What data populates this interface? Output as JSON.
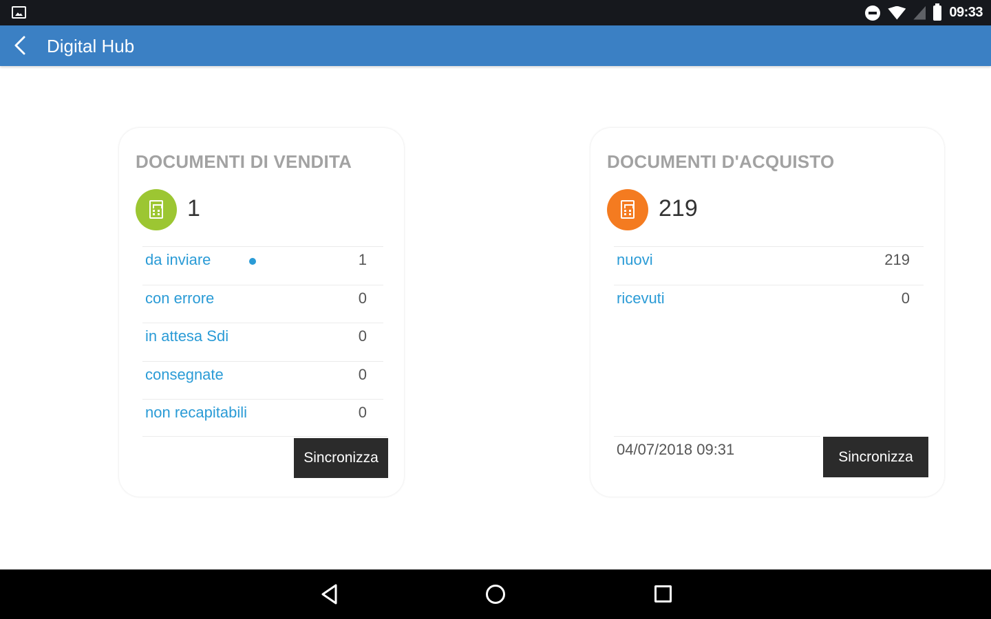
{
  "statusbar": {
    "time": "09:33"
  },
  "appbar": {
    "title": "Digital Hub"
  },
  "sales": {
    "title": "DOCUMENTI DI VENDITA",
    "count": "1",
    "rows": [
      {
        "label": "da inviare",
        "value": "1"
      },
      {
        "label": "con errore",
        "value": "0"
      },
      {
        "label": "in attesa Sdi",
        "value": "0"
      },
      {
        "label": "consegnate",
        "value": "0"
      },
      {
        "label": "non recapitabili",
        "value": "0"
      }
    ],
    "sync_label": "Sincronizza"
  },
  "purchases": {
    "title": "DOCUMENTI D'ACQUISTO",
    "count": "219",
    "rows": [
      {
        "label": "nuovi",
        "value": "219"
      },
      {
        "label": "ricevuti",
        "value": "0"
      }
    ],
    "timestamp": "04/07/2018 09:31",
    "sync_label": "Sincronizza"
  },
  "colors": {
    "appbar": "#3b80c4",
    "sales_badge": "#9cc632",
    "purchases_badge": "#f47b20",
    "link": "#2a9bd6",
    "button": "#2b2b2b"
  },
  "icons": {
    "status_left": "image-icon",
    "dnd": "do-not-disturb-icon",
    "wifi": "wifi-icon",
    "signal": "no-signal-icon",
    "battery": "battery-icon",
    "back": "back-arrow-icon",
    "doc": "document-icon",
    "nav_back": "nav-back-icon",
    "nav_home": "nav-home-icon",
    "nav_recents": "nav-recents-icon"
  }
}
